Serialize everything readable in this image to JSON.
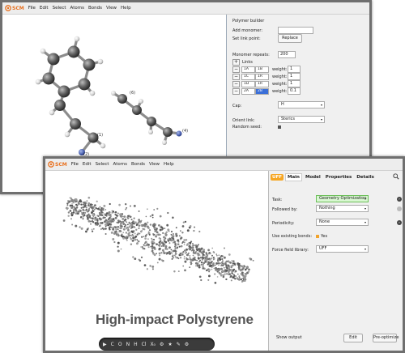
{
  "app": {
    "logo_text": "SCM",
    "menu": [
      "File",
      "Edit",
      "Select",
      "Atoms",
      "Bonds",
      "View",
      "Help"
    ]
  },
  "window1": {
    "atom_labels": [
      "(1)",
      "(2)",
      "(6)",
      "(4)"
    ],
    "polymer_builder": {
      "title": "Polymer builder",
      "add_monomer_label": "Add monomer:",
      "add_monomer_value": "",
      "set_link_point_label": "Set link point:",
      "replace_button": "Replace",
      "monomer_repeats_label": "Monomer repeats:",
      "monomer_repeats_value": "200",
      "links_button": "+",
      "links_label": "Links",
      "link_rows": [
        {
          "minus": "−",
          "a": "1A",
          "b": "1B",
          "weight_label": "weight:",
          "weight": "1"
        },
        {
          "minus": "−",
          "a": "1C",
          "b": "1R",
          "weight_label": "weight:",
          "weight": "1"
        },
        {
          "minus": "−",
          "a": "1D",
          "b": "1R",
          "weight_label": "weight:",
          "weight": "1"
        },
        {
          "minus": "−",
          "a": "2A",
          "b": "2B",
          "weight_label": "weight:",
          "weight": "0.1"
        }
      ],
      "cap_label": "Cap:",
      "cap_value": "H",
      "orient_link_label": "Orient link:",
      "orient_link_value": "Sterics",
      "random_seed_label": "Random seed:"
    }
  },
  "window2": {
    "tabs": [
      "UFF",
      "Main",
      "Model",
      "Properties",
      "Details"
    ],
    "task_label": "Task:",
    "task_value": "Geometry Optimization",
    "followed_by_label": "Followed by:",
    "followed_by_value": "Nothing",
    "periodicity_label": "Periodicity:",
    "periodicity_value": "None",
    "use_existing_bonds_label": "Use existing bonds:",
    "use_existing_bonds_value": "Yes",
    "force_field_label": "Force field library:",
    "force_field_value": "UFF",
    "show_output": "Show output",
    "edit_button": "Edit",
    "pre_optimize_button": "Pre-optimize",
    "toolbar_items": [
      "▶",
      "C",
      "O",
      "N",
      "H",
      "Cl",
      "X₀",
      "⚙",
      "★",
      "✎",
      "⚙"
    ]
  },
  "caption": "High-impact Polystyrene",
  "colors": {
    "accent": "#f6a623",
    "logo": "#e8701e",
    "highlight": "#3b6fd8",
    "task_green": "#d9f8d2"
  }
}
